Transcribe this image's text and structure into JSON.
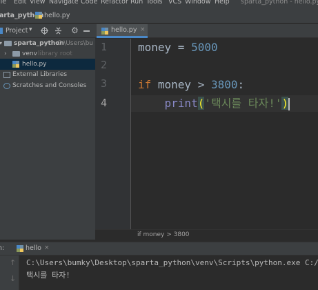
{
  "menu": {
    "items": [
      "ile",
      "Edit",
      "View",
      "Navigate",
      "Code",
      "Refactor",
      "Run",
      "Tools",
      "VCS",
      "Window",
      "Help"
    ],
    "window_title": "sparta_python - hello.py"
  },
  "nav": {
    "project": "arta_python",
    "file": "hello.py"
  },
  "project_panel": {
    "title": "Project",
    "root_name": "sparta_python",
    "root_path": "C:\\Users\\bu",
    "venv_name": "venv",
    "venv_hint": "library root",
    "file_name": "hello.py",
    "external_libraries": "External Libraries",
    "scratches": "Scratches and Consoles"
  },
  "editor": {
    "tab_label": "hello.py",
    "line_numbers": [
      "1",
      "2",
      "3",
      "4"
    ],
    "current_line": 4,
    "lines": {
      "l1_var": "money",
      "l1_op": " = ",
      "l1_num": "5000",
      "l3_kw": "if",
      "l3_mid": " money > ",
      "l3_num": "3800",
      "l3_end": ":",
      "l4_indent": "    ",
      "l4_fn": "print",
      "l4_open": "(",
      "l4_str": "'택시를 타자!'",
      "l4_close": ")"
    },
    "breadcrumb": "if money > 3800"
  },
  "run": {
    "label_prefix": "n:",
    "config_name": "hello",
    "output": [
      "C:\\Users\\bumky\\Desktop\\sparta_python\\venv\\Scripts\\python.exe C:/Us",
      "택시를 타자!"
    ]
  },
  "colors": {
    "keyword": "#cc7832",
    "number": "#6897bb",
    "builtin": "#8888c6",
    "string": "#6a8759",
    "selection": "#0d293e",
    "tab_underline": "#4a88c7"
  }
}
